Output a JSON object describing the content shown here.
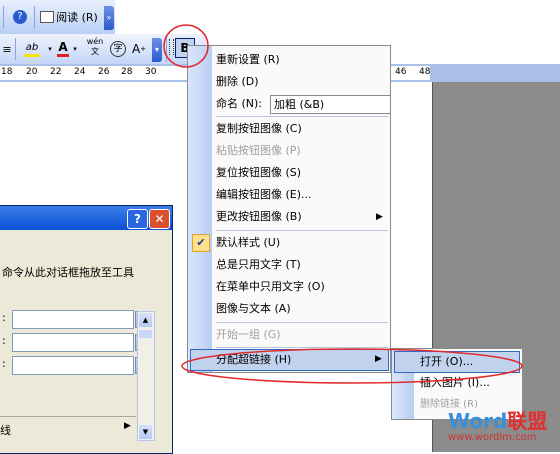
{
  "toolbar1": {
    "help_icon_glyph": "?",
    "read_label": "阅读 (R)",
    "chevron_glyph": "»"
  },
  "toolbar2": {
    "align_glyph": "≡",
    "highlight_glyph": "ab",
    "fontcolor_glyph": "A",
    "phonetic_glyph": "wén\n文",
    "enclosed_glyph": "字",
    "grow_glyph": "A",
    "custom_button_glyph": "B"
  },
  "ruler": {
    "ticks": [
      "18",
      "20",
      "22",
      "24",
      "26",
      "28",
      "30",
      "46",
      "48"
    ]
  },
  "dialog": {
    "help_btn": "?",
    "close_btn": "✕",
    "text": "命令从此对话框拖放至工具",
    "bottom_label": "线"
  },
  "menu": {
    "reset": "重新设置 (R)",
    "delete": "删除 (D)",
    "name_label": "命名 (N):",
    "name_value": "加粗 (&B)",
    "copy_image": "复制按钮图像 (C)",
    "paste_image": "粘贴按钮图像 (P)",
    "reset_image": "复位按钮图像 (S)",
    "edit_image": "编辑按钮图像 (E)...",
    "change_image": "更改按钮图像 (B)",
    "default_style": "默认样式 (U)",
    "text_only_always": "总是只用文字 (T)",
    "text_only_menu": "在菜单中只用文字 (O)",
    "image_and_text": "图像与文本 (A)",
    "begin_group": "开始一组 (G)",
    "assign_hyperlink": "分配超链接 (H)"
  },
  "submenu": {
    "open": "打开 (O)...",
    "insert_picture": "插入图片 (I)...",
    "remove_link": "删除链接 (R)"
  },
  "watermark": {
    "brand_word": "Word",
    "brand_cn": "联盟",
    "url": "www.wordlm.com"
  },
  "colors": {
    "highlight": "#f5e600",
    "font_red": "#e02020",
    "annotation": "#e02a2a"
  }
}
